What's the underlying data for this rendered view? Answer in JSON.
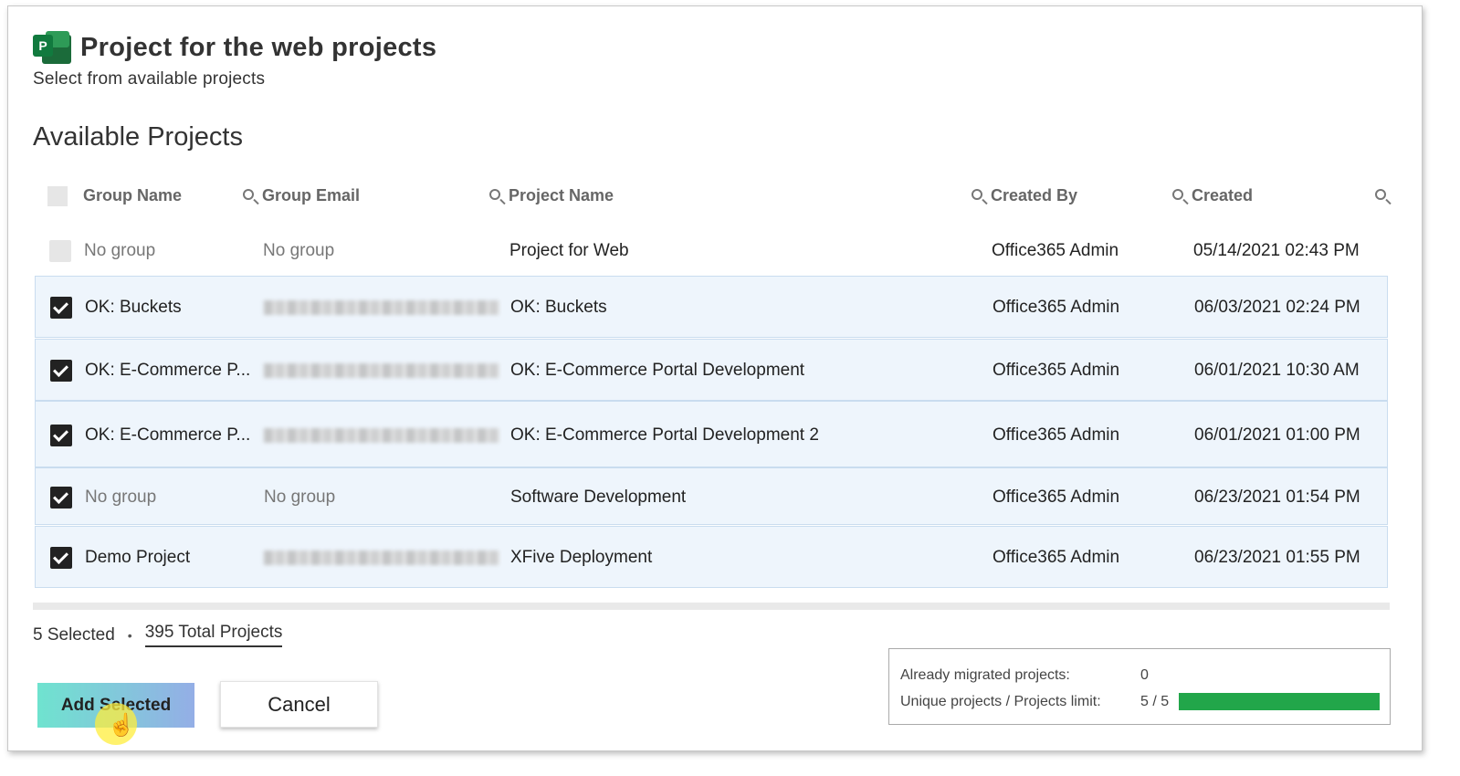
{
  "header": {
    "title": "Project for the web projects",
    "subtitle": "Select from available projects",
    "logo_letter": "P"
  },
  "section_title": "Available Projects",
  "columns": [
    "Group Name",
    "Group Email",
    "Project Name",
    "Created By",
    "Created"
  ],
  "rows": [
    {
      "checked": false,
      "group_name": "No group",
      "group_email": "No group",
      "email_blurred": false,
      "project_name": "Project for Web",
      "created_by": "Office365 Admin",
      "created": "05/14/2021 02:43 PM"
    },
    {
      "checked": true,
      "group_name": "OK: Buckets",
      "group_email": "",
      "email_blurred": true,
      "project_name": "OK: Buckets",
      "created_by": "Office365 Admin",
      "created": "06/03/2021 02:24 PM"
    },
    {
      "checked": true,
      "group_name": "OK: E-Commerce P...",
      "group_email": "",
      "email_blurred": true,
      "project_name": "OK: E-Commerce Portal Development",
      "created_by": "Office365 Admin",
      "created": "06/01/2021 10:30 AM"
    },
    {
      "checked": true,
      "group_name": "OK: E-Commerce P...",
      "group_email": "",
      "email_blurred": true,
      "project_name": "OK: E-Commerce Portal Development 2",
      "created_by": "Office365 Admin",
      "created": "06/01/2021 01:00 PM"
    },
    {
      "checked": true,
      "group_name": "No group",
      "group_email": "No group",
      "email_blurred": false,
      "project_name": "Software Development",
      "created_by": "Office365 Admin",
      "created": "06/23/2021 01:54 PM"
    },
    {
      "checked": true,
      "group_name": "Demo Project",
      "group_email": "",
      "email_blurred": true,
      "project_name": "XFive Deployment",
      "created_by": "Office365 Admin",
      "created": "06/23/2021 01:55 PM"
    }
  ],
  "footer": {
    "selected": "5 Selected",
    "separator": "•",
    "total": "395 Total Projects"
  },
  "buttons": {
    "add": "Add Selected",
    "cancel": "Cancel"
  },
  "stats": {
    "migrated_label": "Already migrated projects:",
    "migrated_value": "0",
    "limit_label": "Unique projects / Projects limit:",
    "limit_value": "5 / 5",
    "limit_fraction": 1.0,
    "bar_color": "#22a64a"
  },
  "icons": [
    "project-logo-icon",
    "search-icon",
    "checkbox-icon",
    "hand-pointer-icon"
  ]
}
